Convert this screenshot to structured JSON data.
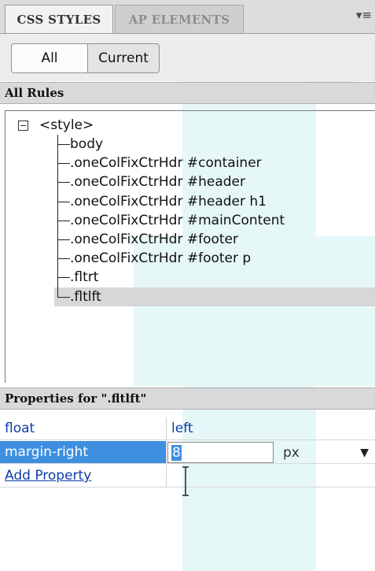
{
  "tabs": [
    {
      "label": "CSS STYLES",
      "active": true
    },
    {
      "label": "AP ELEMENTS",
      "active": false
    }
  ],
  "panel_menu_icon": "panel-menu-icon",
  "mode_toggle": {
    "all": "All",
    "current": "Current",
    "selected": "All"
  },
  "all_rules": {
    "header": "All Rules",
    "root": "<style>",
    "rules": [
      "body",
      ".oneColFixCtrHdr #container",
      ".oneColFixCtrHdr #header",
      ".oneColFixCtrHdr #header h1",
      ".oneColFixCtrHdr #mainContent",
      ".oneColFixCtrHdr #footer",
      ".oneColFixCtrHdr #footer p",
      ".fltrt",
      ".fltlft"
    ],
    "selected_rule": ".fltlft"
  },
  "properties": {
    "header": "Properties for \".fltlft\"",
    "rows": [
      {
        "name": "float",
        "value": "left"
      },
      {
        "name": "margin-right",
        "value": "8",
        "unit": "px"
      }
    ],
    "add_property": "Add Property"
  },
  "colors": {
    "selection": "#3e8fe0",
    "link": "#0b3da8",
    "header_bg": "#d9d9d9"
  }
}
